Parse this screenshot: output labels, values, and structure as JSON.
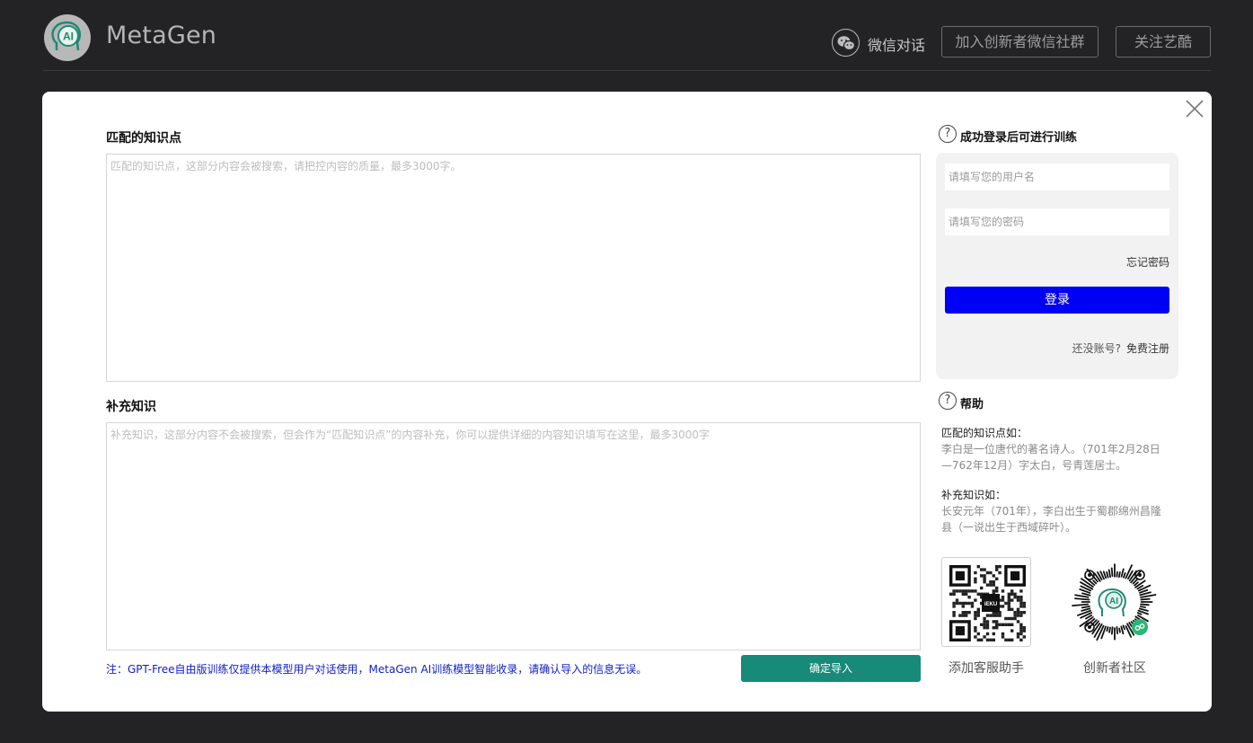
{
  "header": {
    "brand": "MetaGen",
    "logo_text": "AI",
    "wechat_label": "微信对话",
    "join_button": "加入创新者微信社群",
    "follow_button": "关注艺酷"
  },
  "form": {
    "match_label": "匹配的知识点",
    "match_placeholder": "匹配的知识点，这部分内容会被搜索，请把控内容的质量，最多3000字。",
    "supplement_label": "补充知识",
    "supplement_placeholder": "补充知识，这部分内容不会被搜索，但会作为“匹配知识点”的内容补充，你可以提供详细的内容知识填写在这里，最多3000字",
    "note": "注：GPT-Free自由版训练仅提供本模型用户对话使用，MetaGen AI训练模型智能收录，请确认导入的信息无误。",
    "confirm_button": "确定导入"
  },
  "login": {
    "title": "成功登录后可进行训练",
    "username_placeholder": "请填写您的用户名",
    "password_placeholder": "请填写您的密码",
    "forgot": "忘记密码",
    "login_button": "登录",
    "no_account": "还没账号?",
    "register": "免费注册"
  },
  "help": {
    "title": "帮助",
    "match_heading": "匹配的知识点如：",
    "match_example": "李白是一位唐代的著名诗人。（701年2月28日—762年12月）字太白，号青莲居士。",
    "supplement_heading": "补充知识如：",
    "supplement_example": "长安元年（701年），李白出生于蜀郡绵州昌隆县（一说出生于西域碎叶）。"
  },
  "qr": {
    "center_text": "iEKU",
    "assistant_caption": "添加客服助手",
    "community_caption": "创新者社区",
    "miniprog_text": "AI"
  },
  "icons": {
    "help": "?"
  },
  "colors": {
    "background": "#232325",
    "login_button": "#0000f5",
    "confirm_button": "#178a79",
    "note_text": "#1020c8"
  }
}
